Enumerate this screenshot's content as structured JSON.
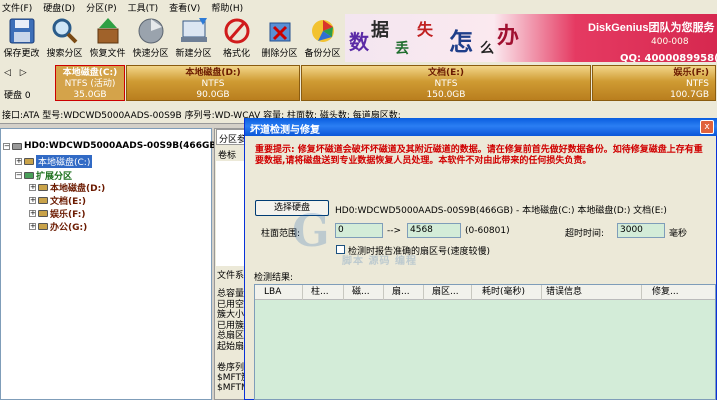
{
  "menu": [
    "文件(F)",
    "硬盘(D)",
    "分区(P)",
    "工具(T)",
    "查看(V)",
    "帮助(H)"
  ],
  "toolbar": [
    {
      "label": "保存更改",
      "icon": "save-icon"
    },
    {
      "label": "搜索分区",
      "icon": "search-icon"
    },
    {
      "label": "恢复文件",
      "icon": "recover-file-icon"
    },
    {
      "label": "快速分区",
      "icon": "quick-partition-icon"
    },
    {
      "label": "新建分区",
      "icon": "new-partition-icon"
    },
    {
      "label": "格式化",
      "icon": "format-icon"
    },
    {
      "label": "删除分区",
      "icon": "delete-partition-icon"
    },
    {
      "label": "备份分区",
      "icon": "backup-partition-icon"
    }
  ],
  "banner": {
    "chars": [
      "数",
      "据",
      "丢",
      "失",
      "怎",
      "么",
      "办"
    ],
    "title": "DiskGenius团队为您服务",
    "url": "400-008",
    "qq": "QQ: 4000089958(与电"
  },
  "disk_map": {
    "nav": "◁ ▷",
    "label": "硬盘 0",
    "partitions": [
      {
        "name": "本地磁盘(C:)",
        "fs": "NTFS (活动)",
        "size": "35.0GB"
      },
      {
        "name": "本地磁盘(D:)",
        "fs": "NTFS",
        "size": "90.0GB"
      },
      {
        "name": "文档(E:)",
        "fs": "NTFS",
        "size": "150.0GB"
      },
      {
        "name": "娱乐(F:)",
        "fs": "NTFS",
        "size": "100.7GB"
      }
    ]
  },
  "infobar": "接口:ATA  型号:WDCWD5000AADS-00S9B  序列号:WD-WCAV  容量:   柱面数:    磁头数:   每道扇区数:",
  "tree": {
    "disk": "HD0:WDCWD5000AADS-00S9B(466GB)",
    "c": "本地磁盘(C:)",
    "ext": "扩展分区",
    "d": "本地磁盘(D:)",
    "e": "文档(E:)",
    "f": "娱乐(F:)",
    "g": "办公(G:)"
  },
  "right_panel": {
    "tab": "分区参",
    "col": "卷标",
    "section": "文件系",
    "fields": [
      "总容量",
      "已用空",
      "簇大小",
      "已用簇",
      "总扇区",
      "起始扇"
    ],
    "seq": [
      "卷序列",
      "$MFT簇",
      "$MFTMi"
    ]
  },
  "dialog": {
    "title": "坏道检测与修复",
    "close": "x",
    "warning": "重要提示: 修复坏磁道会破坏坏磁道及其附近磁道的数据。请在修复前首先做好数据备份。如待修复磁盘上存有重要数据,请将磁盘送到专业数据恢复人员处理。本软件不对由此带来的任何损失负责。",
    "select_disk_button": "选择硬盘",
    "disk_desc": "HD0:WDCWD5000AADS-00S9B(466GB) - 本地磁盘(C:) 本地磁盘(D:) 文档(E:)",
    "cyl_label": "柱面范围:",
    "cyl_from": "0",
    "arrow": "-->",
    "cyl_to": "4568",
    "cyl_range": "(0-60801)",
    "timeout_label": "超时时间:",
    "timeout_value": "3000",
    "ms_label": "毫秒",
    "checkbox_label": "检测时报告准确的扇区号(速度较慢)",
    "results_label": "检测结果:",
    "columns": [
      "LBA",
      "柱...",
      "磁...",
      "扇...",
      "扇区...",
      "耗时(毫秒)",
      "错误信息",
      "修复..."
    ]
  },
  "watermark": {
    "letter": "G",
    "text": "脚本 源码 编程"
  },
  "colors": {
    "accent": "#0a5ddf",
    "warning": "#d00000",
    "field_bg": "#d3ecd8"
  }
}
